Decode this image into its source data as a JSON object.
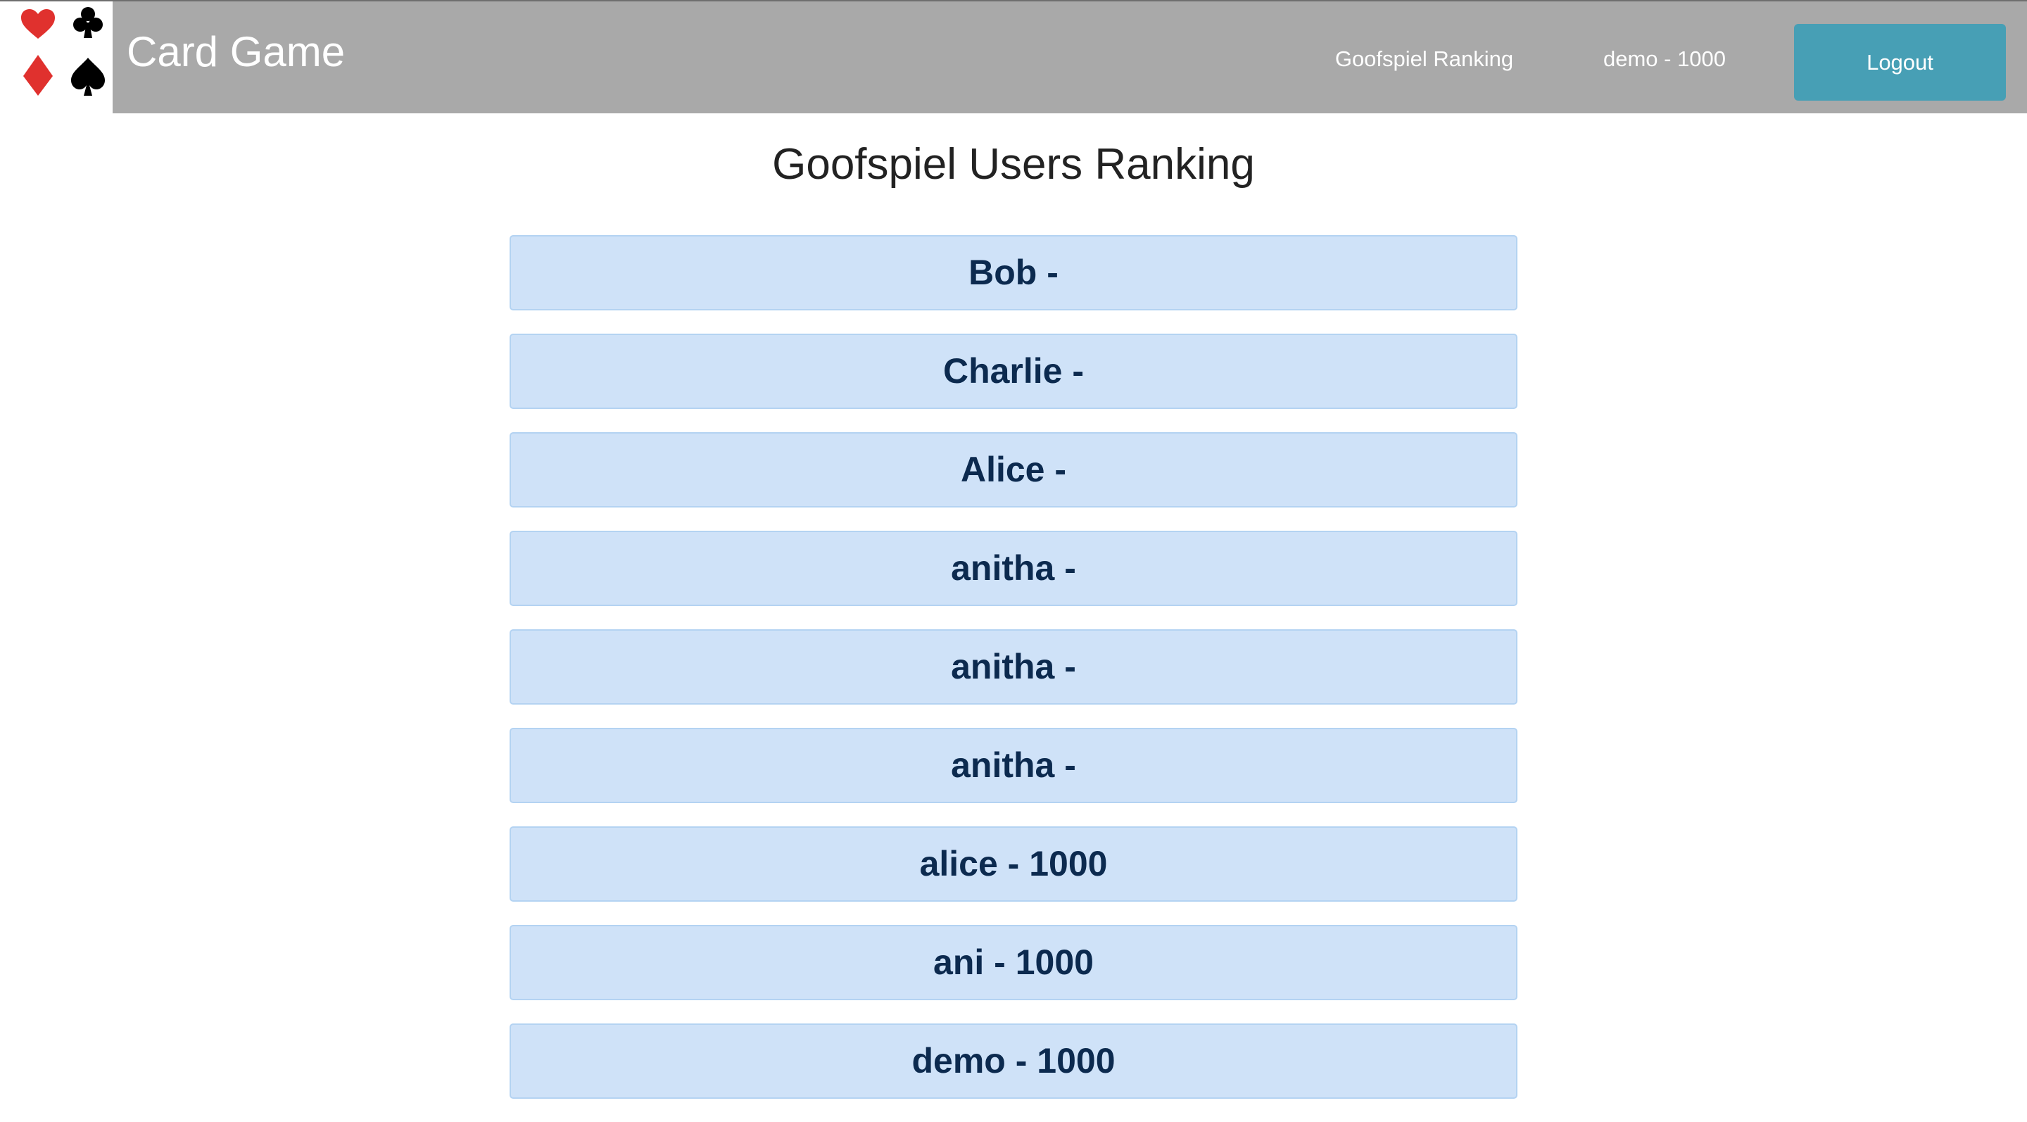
{
  "header": {
    "brand": "Card Game",
    "logo_icon": "playing-card-suits-icon",
    "nav_links": {
      "ranking": "Goofspiel Ranking",
      "user": "demo - 1000"
    },
    "logout_label": "Logout"
  },
  "colors": {
    "navbar": "#a9a9a9",
    "logout_button": "#479fb5",
    "hearts_diamonds": "#e0312e",
    "clubs_spades": "#000000",
    "ranking_item_bg": "#cfe2f8",
    "ranking_item_text": "#0c2a4f"
  },
  "main": {
    "title": "Goofspiel Users Ranking",
    "ranking": [
      "Bob -",
      "Charlie -",
      "Alice -",
      "anitha -",
      "anitha -",
      "anitha -",
      "alice - 1000",
      "ani - 1000",
      "demo - 1000"
    ]
  }
}
